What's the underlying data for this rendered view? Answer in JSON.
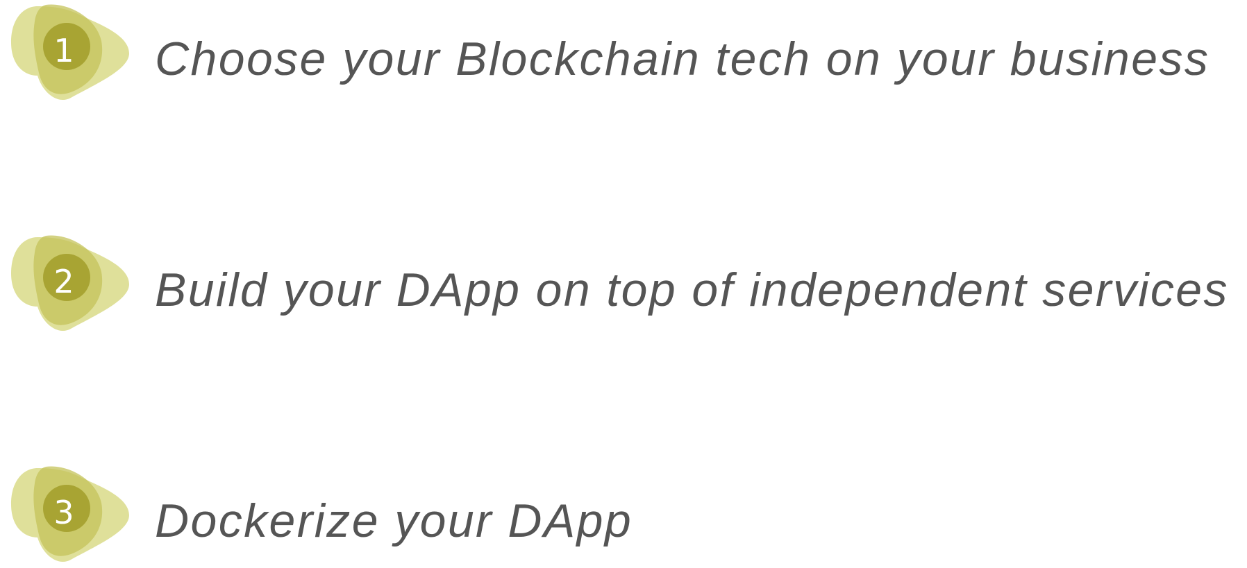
{
  "colors": {
    "blob_outer": "#dfe09a",
    "blob_middle": "#c4c35a",
    "blob_inner": "#a8a433",
    "number_text": "#ffffff",
    "step_text": "#555555",
    "background": "#ffffff"
  },
  "steps": [
    {
      "number": "1",
      "text": "Choose your Blockchain tech on your business",
      "icon": "blob-number-badge-icon"
    },
    {
      "number": "2",
      "text": "Build your DApp on top of independent services",
      "icon": "blob-number-badge-icon"
    },
    {
      "number": "3",
      "text": "Dockerize your DApp",
      "icon": "blob-number-badge-icon"
    }
  ]
}
